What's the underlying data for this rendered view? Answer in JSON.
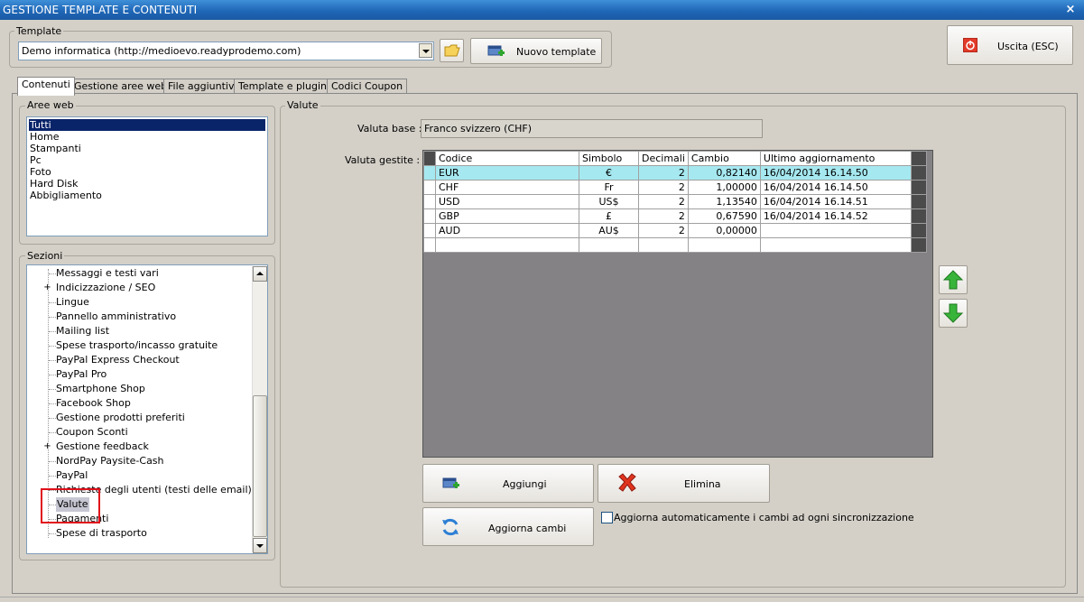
{
  "window": {
    "title": "GESTIONE TEMPLATE E CONTENUTI",
    "close_glyph": "×"
  },
  "template_group": {
    "label": "Template",
    "selected_value": "Demo informatica (http://medioevo.readyprodemo.com)",
    "new_button_label": "Nuovo template"
  },
  "exit_button_label": "Uscita (ESC)",
  "tabs": [
    {
      "label": "Contenuti",
      "active": true
    },
    {
      "label": "Gestione aree web"
    },
    {
      "label": "File aggiuntivi"
    },
    {
      "label": "Template e plugins"
    },
    {
      "label": "Codici Coupon"
    }
  ],
  "web_areas": {
    "label": "Aree web",
    "items": [
      "Tutti",
      "Home",
      "Stampanti",
      "Pc",
      "Foto",
      "Hard Disk",
      "Abbigliamento"
    ],
    "selected": "Tutti"
  },
  "sections": {
    "label": "Sezioni",
    "items": [
      {
        "label": "Messaggi e testi vari"
      },
      {
        "label": "Indicizzazione / SEO",
        "expander": "+"
      },
      {
        "label": "Lingue"
      },
      {
        "label": "Pannello amministrativo"
      },
      {
        "label": "Mailing list"
      },
      {
        "label": "Spese trasporto/incasso gratuite"
      },
      {
        "label": "PayPal Express Checkout"
      },
      {
        "label": "PayPal Pro"
      },
      {
        "label": "Smartphone Shop"
      },
      {
        "label": "Facebook Shop"
      },
      {
        "label": "Gestione prodotti preferiti"
      },
      {
        "label": "Coupon Sconti"
      },
      {
        "label": "Gestione feedback",
        "expander": "+"
      },
      {
        "label": "NordPay Paysite-Cash"
      },
      {
        "label": "PayPal"
      },
      {
        "label": "Richieste degli utenti (testi delle email)"
      },
      {
        "label": "Valute",
        "selected": true
      },
      {
        "label": "Pagamenti"
      },
      {
        "label": "Spese di trasporto"
      }
    ]
  },
  "valute": {
    "label": "Valute",
    "base_label": "Valuta base :",
    "base_value": "Franco svizzero (CHF)",
    "managed_label": "Valuta gestite :",
    "columns": [
      "Codice",
      "Simbolo",
      "Decimali",
      "Cambio",
      "Ultimo aggiornamento"
    ],
    "rows": [
      {
        "code": "EUR",
        "symbol": "€",
        "decimals": "2",
        "rate": "0,82140",
        "updated": "16/04/2014 16.14.50"
      },
      {
        "code": "CHF",
        "symbol": "Fr",
        "decimals": "2",
        "rate": "1,00000",
        "updated": "16/04/2014 16.14.50"
      },
      {
        "code": "USD",
        "symbol": "US$",
        "decimals": "2",
        "rate": "1,13540",
        "updated": "16/04/2014 16.14.51"
      },
      {
        "code": "GBP",
        "symbol": "£",
        "decimals": "2",
        "rate": "0,67590",
        "updated": "16/04/2014 16.14.52"
      },
      {
        "code": "AUD",
        "symbol": "AU$",
        "decimals": "2",
        "rate": "0,00000",
        "updated": ""
      }
    ],
    "selected_row": 0,
    "add_label": "Aggiungi",
    "delete_label": "Elimina",
    "update_rates_label": "Aggiorna cambi",
    "auto_update_label": "Aggiorna automaticamente i cambi ad ogni sincronizzazione",
    "auto_update_checked": false
  },
  "colors": {
    "title_bar": "#1f67b7",
    "selection": "#0a246a",
    "grid_selected_row": "#a6e8f0",
    "highlight_box": "#e0101a"
  }
}
